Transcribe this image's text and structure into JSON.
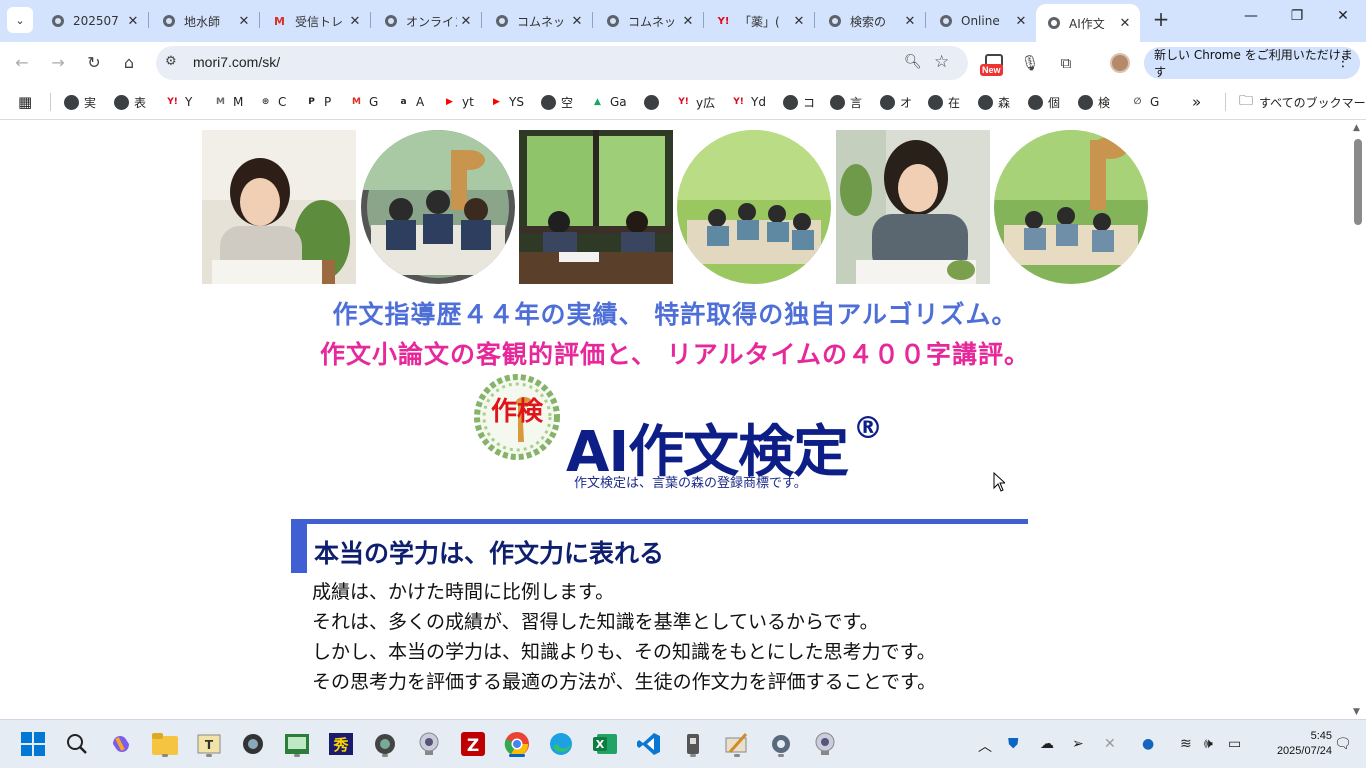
{
  "browser": {
    "tabs": [
      {
        "title": "202507",
        "favicon": "globe-icon",
        "active": false
      },
      {
        "title": "地水師",
        "favicon": "globe-icon",
        "active": false
      },
      {
        "title": "受信トレ",
        "favicon": "gmail-icon",
        "active": false
      },
      {
        "title": "オンライン",
        "favicon": "globe-icon",
        "active": false
      },
      {
        "title": "コムネッ",
        "favicon": "globe-icon",
        "active": false
      },
      {
        "title": "コムネッ",
        "favicon": "globe-icon",
        "active": false
      },
      {
        "title": "「薬」(",
        "favicon": "yahoo-icon",
        "active": false
      },
      {
        "title": "検索の",
        "favicon": "globe-icon",
        "active": false
      },
      {
        "title": "Online",
        "favicon": "globe-icon",
        "active": false
      },
      {
        "title": "AI作文",
        "favicon": "globe-icon",
        "active": true
      }
    ],
    "url": "mori7.com/sk/",
    "ext_badge": "New",
    "update_text": "新しい Chrome をご利用いただけます",
    "bookmarks": [
      {
        "label": "実",
        "icon": "globe"
      },
      {
        "label": "表",
        "icon": "globe"
      },
      {
        "label": "Y",
        "icon": "yahoo"
      },
      {
        "label": "M",
        "icon": "m"
      },
      {
        "label": "C",
        "icon": "openai"
      },
      {
        "label": "P",
        "icon": "p"
      },
      {
        "label": "G",
        "icon": "gmail"
      },
      {
        "label": "A",
        "icon": "amazon"
      },
      {
        "label": "yt",
        "icon": "youtube"
      },
      {
        "label": "YS",
        "icon": "youtube"
      },
      {
        "label": "空",
        "icon": "globe"
      },
      {
        "label": "Ga",
        "icon": "drive"
      },
      {
        "label": "",
        "icon": "globe"
      },
      {
        "label": "y広",
        "icon": "yahoo"
      },
      {
        "label": "Yd",
        "icon": "yahoo"
      },
      {
        "label": "コ",
        "icon": "globe"
      },
      {
        "label": "言",
        "icon": "globe"
      },
      {
        "label": "オ",
        "icon": "globe"
      },
      {
        "label": "在",
        "icon": "globe"
      },
      {
        "label": "森",
        "icon": "globe"
      },
      {
        "label": "個",
        "icon": "globe"
      },
      {
        "label": "検",
        "icon": "globe"
      },
      {
        "label": "G",
        "icon": "link"
      }
    ],
    "all_bookmarks": "すべてのブックマーク",
    "overflow_label": "»"
  },
  "page": {
    "headline1": "作文指導歴４４年の実績、 特許取得の独自アルゴリズム。",
    "headline2": "作文小論文の客観的評価と、 リアルタイムの４００字講評。",
    "logo_text": "作検",
    "brand_title": "AI作文検定",
    "brand_registered": "®",
    "trademark_note": "作文検定は、言葉の森の登録商標です。",
    "section_title": "本当の学力は、作文力に表れる",
    "paragraphs": [
      "成績は、かけた時間に比例します。",
      "それは、多くの成績が、習得した知識を基準としているからです。",
      "しかし、本当の学力は、知識よりも、その知識をもとにした思考力です。",
      "その思考力を評価する最適の方法が、生徒の作文力を評価することです。"
    ]
  },
  "taskbar": {
    "clock_time": "5:45",
    "clock_date": "2025/07/24"
  },
  "colors": {
    "tabbar": "#d3e3fd",
    "headline1": "#4f6fd8",
    "headline2": "#e7289b",
    "brand": "#0d1f87",
    "section_bar": "#3f5fd3"
  }
}
